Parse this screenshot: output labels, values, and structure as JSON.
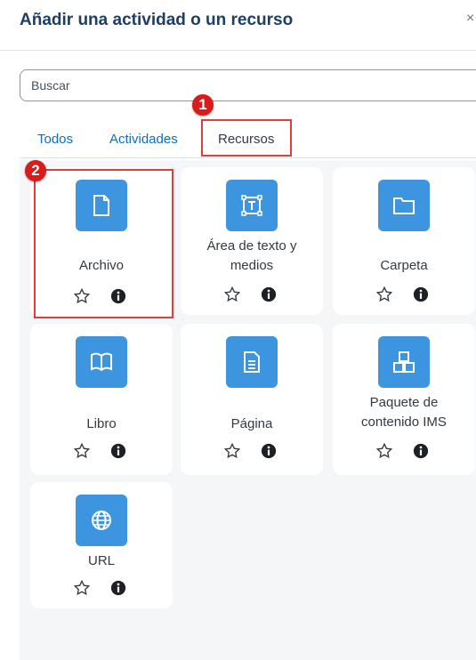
{
  "header": {
    "title": "Añadir una actividad o un recurso",
    "close_glyph": "×"
  },
  "search": {
    "placeholder": "Buscar"
  },
  "tabs": [
    {
      "label": "Todos",
      "active": false
    },
    {
      "label": "Actividades",
      "active": false
    },
    {
      "label": "Recursos",
      "active": true
    }
  ],
  "markers": [
    "1",
    "2"
  ],
  "items": [
    {
      "line1": "Archivo",
      "line2": "",
      "icon": "file-icon"
    },
    {
      "line1": "Área de texto y",
      "line2": "medios",
      "icon": "text-area-icon"
    },
    {
      "line1": "Carpeta",
      "line2": "",
      "icon": "folder-icon"
    },
    {
      "line1": "Libro",
      "line2": "",
      "icon": "book-icon"
    },
    {
      "line1": "Página",
      "line2": "",
      "icon": "page-icon"
    },
    {
      "line1": "Paquete de",
      "line2": "contenido IMS",
      "icon": "ims-package-icon"
    },
    {
      "line1": "URL",
      "line2": "",
      "icon": "globe-icon"
    }
  ],
  "colors": {
    "accent": "#3d95e0",
    "highlight": "#e33e3e",
    "link": "#0f6cbf",
    "title": "#1d3f66"
  }
}
